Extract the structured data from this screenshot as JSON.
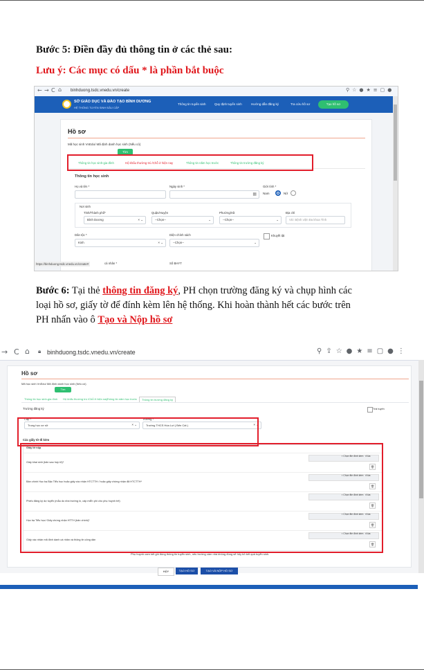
{
  "step5": {
    "title": "Bước 5: Điền đầy đủ thông tin ở các thẻ sau:",
    "note": "Lưu ý: Các mục có dấu * là phần bắt buộc"
  },
  "shot1": {
    "url": "binhduong.tsdc.vnedu.vn/create",
    "brand_title": "SỞ GIÁO DỤC VÀ ĐÀO TẠO BÌNH DƯƠNG",
    "brand_sub": "HỆ THỐNG TUYỂN SINH ĐẦU CẤP",
    "nav": [
      "Thông tin tuyển sinh",
      "Quy định tuyển sinh",
      "Hướng dẫn đăng ký",
      "Tra cứu hồ sơ"
    ],
    "create_btn": "Tạo hồ sơ",
    "page_title": "Hồ sơ",
    "code_label": "Mã học sinh VnEdu/ Mã định danh học sinh (Nếu có)",
    "search_btn": "Tìm",
    "tabs": [
      "Thông tin học sinh-gia đình",
      "Hộ khẩu thường trú /Chỗ ở hiện nay",
      "Thông tin năm học trước",
      "Thông tin trường đăng ký"
    ],
    "section": "Thông tin học sinh",
    "name_label": "Họ và tên *",
    "dob_label": "Ngày sinh *",
    "gender_label": "Giới tính *",
    "male": "Nam",
    "female": "Nữ",
    "birthplace": "Nơi sinh",
    "province_label": "Tỉnh/Thành phố*",
    "province_val": "Bình Dương",
    "district_label": "Quận/Huyện",
    "district_val": "--Chọn--",
    "ward_label": "Phường/Xã",
    "ward_val": "--Chọn--",
    "address_label": "Địa chỉ",
    "address_ph": "VD: Bệnh viện Đa khoa Tỉnh",
    "ethnic_label": "Dân tộc *",
    "ethnic_val": "Kinh",
    "policy_label": "Diện chính sách",
    "policy_val": "--Chọn--",
    "disability": "Khuyết tật",
    "id_label": "cá nhân *",
    "insurance_label": "Số BHYT",
    "status_url": "https://binhduong.tsdc.vnedu.vn/create#"
  },
  "step6": {
    "line1_a": "Bước 6:",
    "line1_b": " Tại thẻ ",
    "line1_link": "thông tin đăng ký",
    "line1_c": ", PH chọn trường đăng ký và chụp hình các",
    "line2": "loại hồ sơ, giấy tờ để đính kèm lên hệ thống. Khi hoàn thành hết các bước trên",
    "line3_a": "PH nhấn vào ô ",
    "line3_link": "Tạo và Nộp hồ sơ"
  },
  "shot2": {
    "url": "binhduong.tsdc.vnedu.vn/create",
    "page_title": "Hồ sơ",
    "code_label": "Mã học sinh VnEdu/ Mã định danh học sinh (Nếu có)",
    "search_btn": "Tìm",
    "tabs": [
      "Thông tin học sinh-gia đình",
      "Hộ khẩu thường trú /Chỗ ở hiện nay",
      "Thông tin năm học trước",
      "Thông tin trường đăng ký"
    ],
    "section": "Trường đăng ký",
    "out_of_area": "Trái tuyến",
    "level_label": "Cấp *",
    "level_val": "Trung học cơ sở",
    "school_label": "Trường *",
    "school_val": "Trường THCS Hòa Lợi ( Bến Cát )",
    "docs_title": "Các giấy tờ đi kèm",
    "docs_header": "Giấy tờ nộp",
    "docs": [
      "Giấy khai sinh (bản sao hợp lệ)*",
      "Bản chính Học bạ Bậc Tiểu học hoặc giấy xác nhận HTCTTH / hoặc giấy chứng nhận đã HTCTTH*",
      "Phiếu đăng ký dự tuyển (mẫu do nhà trường in, cấp miễn phí cho phụ huynh trẻ)",
      "Học bạ Tiểu học/ Giấy chứng nhận HTTH (bản chính)*",
      "Giấy xác nhận mã định danh cá nhân và thông tin công dân"
    ],
    "choose_file": "Chọn file đính kèm",
    "delete": "Xóa",
    "warning": "Phụ huynh cam kết ghi đúng thông tin tuyển sinh, nếu trường cảm nhà không đúng sẽ hủy bỏ kết quả tuyển sinh.",
    "btn_cancel": "HỦY",
    "btn_create": "TẠO HỒ SƠ",
    "btn_submit": "TẠO VÀ NỘP HỒ SƠ"
  }
}
